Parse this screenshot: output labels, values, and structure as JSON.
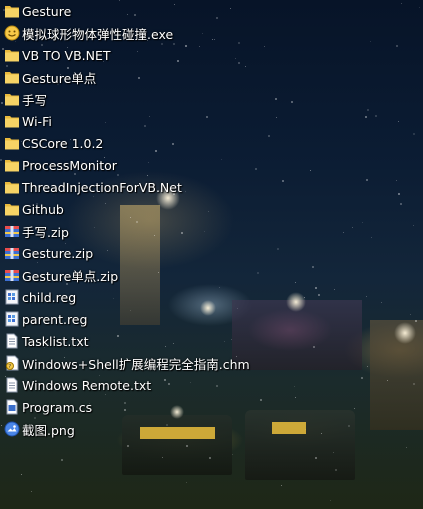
{
  "desktop": {
    "items": [
      {
        "label": "Gesture",
        "icon": "folder-icon"
      },
      {
        "label": "模拟球形物体弹性碰撞.exe",
        "icon": "exe-smiley-icon"
      },
      {
        "label": "VB TO VB.NET",
        "icon": "folder-icon"
      },
      {
        "label": "Gesture单点",
        "icon": "folder-icon"
      },
      {
        "label": "手写",
        "icon": "folder-icon"
      },
      {
        "label": "Wi-Fi",
        "icon": "folder-icon"
      },
      {
        "label": "CSCore 1.0.2",
        "icon": "folder-icon"
      },
      {
        "label": "ProcessMonitor",
        "icon": "folder-icon"
      },
      {
        "label": "ThreadInjectionForVB.Net",
        "icon": "folder-icon"
      },
      {
        "label": "Github",
        "icon": "folder-icon"
      },
      {
        "label": "手写.zip",
        "icon": "zip-archive-icon"
      },
      {
        "label": "Gesture.zip",
        "icon": "zip-archive-icon"
      },
      {
        "label": "Gesture单点.zip",
        "icon": "zip-archive-icon"
      },
      {
        "label": "child.reg",
        "icon": "registry-file-icon"
      },
      {
        "label": "parent.reg",
        "icon": "registry-file-icon"
      },
      {
        "label": "Tasklist.txt",
        "icon": "text-file-icon"
      },
      {
        "label": "Windows+Shell扩展编程完全指南.chm",
        "icon": "chm-help-icon"
      },
      {
        "label": "Windows Remote.txt",
        "icon": "text-file-icon"
      },
      {
        "label": "Program.cs",
        "icon": "code-file-icon"
      },
      {
        "label": "截图.png",
        "icon": "image-file-icon"
      }
    ]
  },
  "colors": {
    "folder": "#f2c94c",
    "label_text": "#ffffff"
  }
}
